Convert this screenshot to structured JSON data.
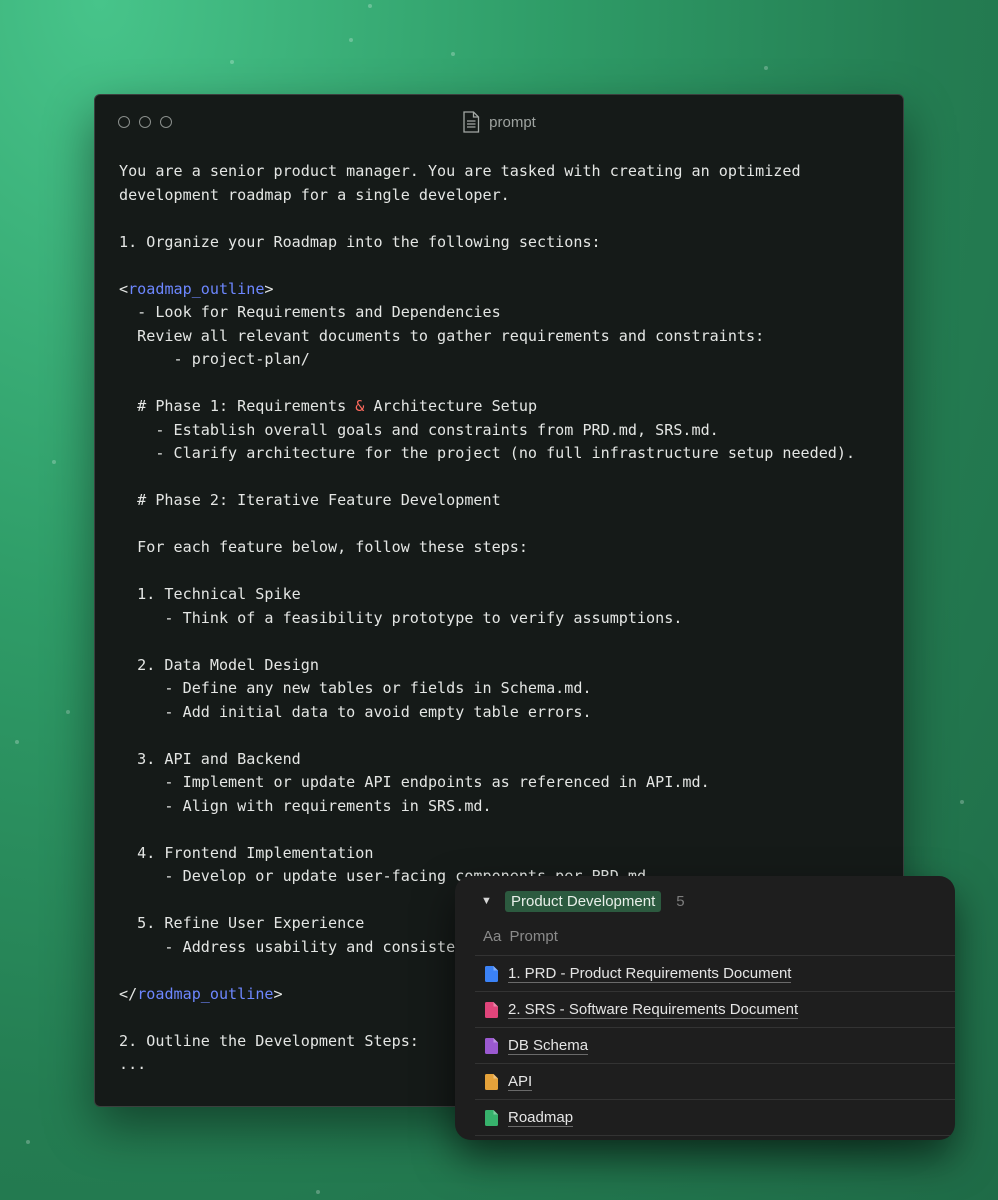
{
  "window": {
    "title": "prompt",
    "icon": "document-icon"
  },
  "editor": {
    "lines": [
      [
        {
          "t": "You are a senior product manager. You are tasked with creating an optimized"
        }
      ],
      [
        {
          "t": "development roadmap for a single developer."
        }
      ],
      [],
      [
        {
          "t": "1. Organize your Roadmap into the following sections:"
        }
      ],
      [],
      [
        {
          "t": "<"
        },
        {
          "t": "roadmap_outline",
          "c": "tag"
        },
        {
          "t": ">"
        }
      ],
      [
        {
          "t": "  - Look for Requirements and Dependencies"
        }
      ],
      [
        {
          "t": "  Review all relevant documents to gather requirements and constraints:"
        }
      ],
      [
        {
          "t": "      - project-plan/"
        }
      ],
      [],
      [
        {
          "t": "  # Phase 1: Requirements "
        },
        {
          "t": "&",
          "c": "amp"
        },
        {
          "t": " Architecture Setup"
        }
      ],
      [
        {
          "t": "    - Establish overall goals and constraints from PRD.md, SRS.md."
        }
      ],
      [
        {
          "t": "    - Clarify architecture for the project (no full infrastructure setup needed)."
        }
      ],
      [],
      [
        {
          "t": "  # Phase 2: Iterative Feature Development"
        }
      ],
      [],
      [
        {
          "t": "  For each feature below, follow these steps:"
        }
      ],
      [],
      [
        {
          "t": "  1. Technical Spike"
        }
      ],
      [
        {
          "t": "     - Think of a feasibility prototype to verify assumptions."
        }
      ],
      [],
      [
        {
          "t": "  2. Data Model Design"
        }
      ],
      [
        {
          "t": "     - Define any new tables or fields in Schema.md."
        }
      ],
      [
        {
          "t": "     - Add initial data to avoid empty table errors."
        }
      ],
      [],
      [
        {
          "t": "  3. API and Backend"
        }
      ],
      [
        {
          "t": "     - Implement or update API endpoints as referenced in API.md."
        }
      ],
      [
        {
          "t": "     - Align with requirements in SRS.md."
        }
      ],
      [],
      [
        {
          "t": "  4. Frontend Implementation"
        }
      ],
      [
        {
          "t": "     - Develop or update user-facing components per PRD.md"
        }
      ],
      [],
      [
        {
          "t": "  5. Refine User Experience"
        }
      ],
      [
        {
          "t": "     - Address usability and consistency"
        }
      ],
      [],
      [
        {
          "t": "</"
        },
        {
          "t": "roadmap_outline",
          "c": "tag"
        },
        {
          "t": ">"
        }
      ],
      [],
      [
        {
          "t": "2. Outline the Development Steps:"
        }
      ],
      [
        {
          "t": "..."
        }
      ]
    ]
  },
  "database": {
    "name": "Product Development",
    "count": "5",
    "column_prefix": "Aa",
    "column_header": "Prompt",
    "rows": [
      {
        "label": "1. PRD - Product Requirements Document",
        "icon": "blue-document-icon",
        "color": "#3b82f6"
      },
      {
        "label": "2. SRS - Software Requirements Document",
        "icon": "pink-document-icon",
        "color": "#e0457b"
      },
      {
        "label": "DB Schema",
        "icon": "purple-document-icon",
        "color": "#9b59d0"
      },
      {
        "label": "API",
        "icon": "yellow-document-icon",
        "color": "#e5a23a"
      },
      {
        "label": "Roadmap",
        "icon": "green-document-icon",
        "color": "#37b26c"
      }
    ]
  },
  "colors": {
    "background_top": "#47c48a",
    "background_bottom": "#1f6b47",
    "editor_bg": "#151a18",
    "tag": "#6d87ff",
    "ampersand": "#ff6b5e",
    "badge_bg": "#2c5a3f"
  }
}
